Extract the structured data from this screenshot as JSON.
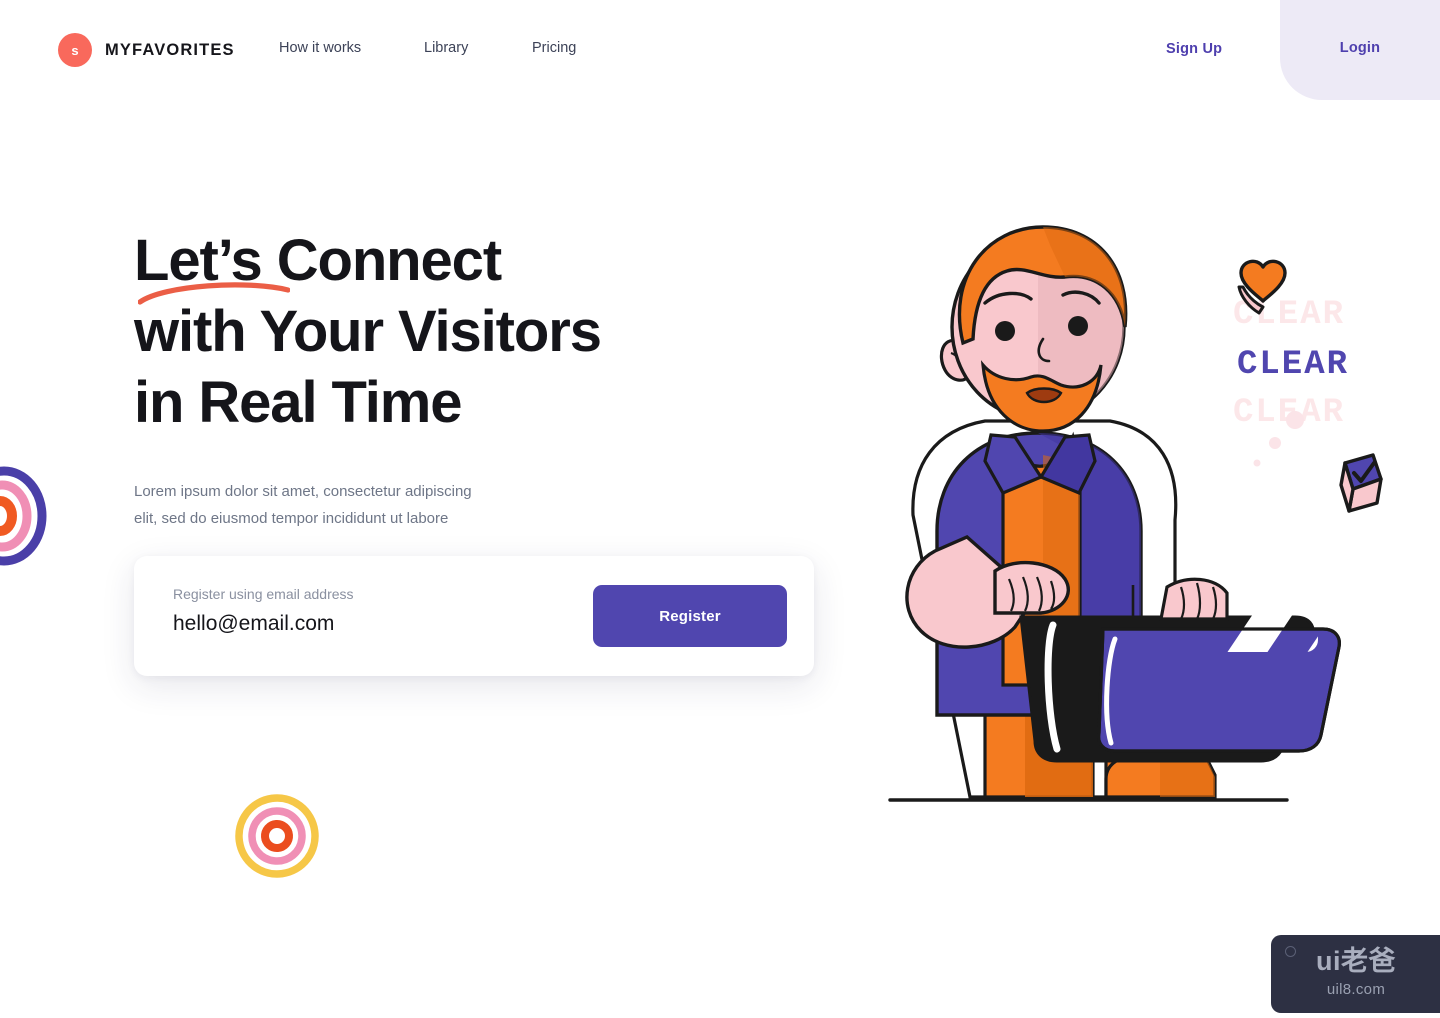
{
  "nav": {
    "logo_letter": "s",
    "logo_color": "#F9695C",
    "brand_name": "MYFAVORITES",
    "links": [
      {
        "label": "How it works"
      },
      {
        "label": "Library"
      },
      {
        "label": "Pricing"
      }
    ],
    "signup_label": "Sign Up",
    "login_label": "Login",
    "login_panel_color": "#EDEAF6",
    "link_color": "#4E3FAE"
  },
  "hero": {
    "headline_lines": [
      "Let’s Connect",
      "with Your Visitors",
      "in Real Time"
    ],
    "subtitle_lines": [
      "Lorem ipsum dolor sit amet, consectetur adipiscing",
      "elit, sed do eiusmod tempor incididunt ut labore"
    ],
    "underline_color": "#EB5E46"
  },
  "form": {
    "label": "Register using email address",
    "email_value": "hello@email.com",
    "email_placeholder": "hello@email.com",
    "button_label": "Register",
    "button_color": "#5046AF"
  },
  "illustration": {
    "banner_text": "CLEAR",
    "banner_color": "#5046AF",
    "hair_color": "#F47B20",
    "skin_color": "#F9C8CD",
    "shirt_color": "#5046AF",
    "tshirt_color": "#F47B20",
    "pants_color": "#F47B20",
    "laptop_color": "#1A1A1A",
    "screen_color": "#5046AF",
    "heart_color": "#F47B20",
    "cube_top_color": "#5046AF",
    "cube_side_color": "#F9C8CD"
  },
  "decor": {
    "target_left": {
      "outer": "#4A3FA8",
      "middle": "#F08FB5",
      "inner": "#F05A22"
    },
    "target_bottom": {
      "outer": "#F6C747",
      "middle": "#F08FB5",
      "inner": "#EB4D1E"
    },
    "dot_color": "#FBE4E8"
  },
  "watermark": {
    "main": "ui老爸",
    "sub": "uil8.com"
  }
}
